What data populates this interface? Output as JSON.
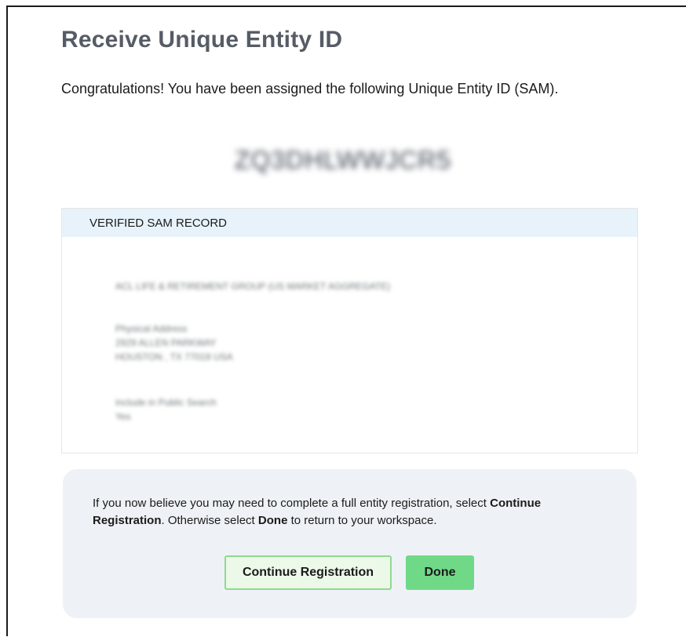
{
  "page": {
    "title": "Receive Unique Entity ID",
    "intro": "Congratulations! You have been assigned the following Unique Entity ID (SAM).",
    "uei": "ZQ3DHLWWJCR5"
  },
  "record": {
    "header": "VERIFIED SAM RECORD",
    "entity_name": "ACL LIFE & RETIREMENT GROUP (US MARKET AGGREGATE)",
    "address_label": "Physical Address",
    "address_line1": "2929 ALLEN PARKWAY",
    "address_line2": "HOUSTON , TX 77019 USA",
    "public_search_label": "Include in Public Search",
    "public_search_value": "Yes"
  },
  "notice": {
    "text_part1": "If you now believe you may need to complete a full entity registration, select ",
    "continue_bold": "Continue Registration",
    "text_part2": ". Otherwise select ",
    "done_bold": "Done",
    "text_part3": " to return to your workspace."
  },
  "buttons": {
    "continue_label": "Continue Registration",
    "done_label": "Done"
  },
  "colors": {
    "title": "#565c65",
    "record_header_bg": "#e7f2fa",
    "notice_bg": "#eef2f6",
    "continue_bg": "#ecf8e8",
    "continue_border": "#8fd990",
    "done_bg": "#70d987"
  }
}
